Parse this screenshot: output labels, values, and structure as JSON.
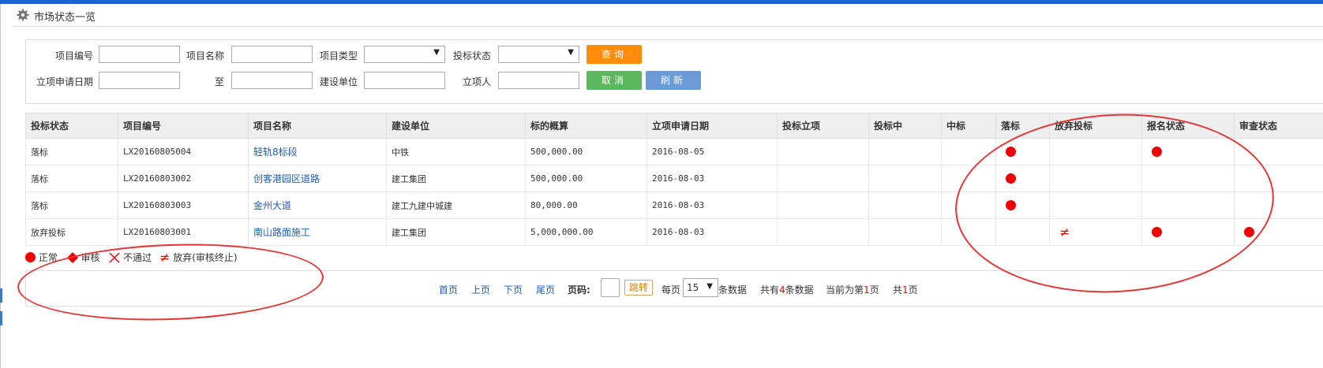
{
  "page": {
    "title": "市场状态一览"
  },
  "search": {
    "row1": [
      {
        "label": "项目编号",
        "type": "input",
        "value": ""
      },
      {
        "label": "项目名称",
        "type": "input",
        "value": ""
      },
      {
        "label": "项目类型",
        "type": "select",
        "value": ""
      },
      {
        "label": "投标状态",
        "type": "select",
        "value": ""
      }
    ],
    "row2": [
      {
        "label": "立项申请日期",
        "type": "input",
        "value": ""
      },
      {
        "label": "至",
        "type": "input",
        "value": ""
      },
      {
        "label": "建设单位",
        "type": "input",
        "value": ""
      },
      {
        "label": "立项人",
        "type": "input",
        "value": ""
      }
    ],
    "query_label": "查询",
    "cancel_label": "取消",
    "refresh_label": "刷新"
  },
  "table": {
    "columns": [
      "投标状态",
      "项目编号",
      "项目名称",
      "建设单位",
      "标的概算",
      "立项申请日期",
      "投标立项",
      "投标中",
      "中标",
      "落标",
      "放弃投标",
      "报名状态",
      "审查状态"
    ],
    "rows": [
      {
        "status": "落标",
        "code": "LX20160805004",
        "name": "轻轨8标段",
        "unit": "中铁",
        "budget": "500,000.00",
        "date": "2016-08-05",
        "marks": {
          "落标": "dot",
          "报名状态": "dot"
        }
      },
      {
        "status": "落标",
        "code": "LX20160803002",
        "name": "创客港园区道路",
        "unit": "建工集团",
        "budget": "500,000.00",
        "date": "2016-08-03",
        "marks": {
          "落标": "dot"
        }
      },
      {
        "status": "落标",
        "code": "LX20160803003",
        "name": "金州大道",
        "unit": "建工九建中城建",
        "budget": "80,000.00",
        "date": "2016-08-03",
        "marks": {
          "落标": "dot"
        }
      },
      {
        "status": "放弃投标",
        "code": "LX20160803001",
        "name": "南山路面施工",
        "unit": "建工集团",
        "budget": "5,000,000.00",
        "date": "2016-08-03",
        "marks": {
          "放弃投标": "neq",
          "报名状态": "dot",
          "审查状态": "dot"
        }
      }
    ]
  },
  "legend": {
    "normal": "正常",
    "review": "审核",
    "rejected": "不通过",
    "abandoned": "放弃(审核终止)"
  },
  "pager": {
    "first": "首页",
    "prev": "上页",
    "next": "下页",
    "last": "尾页",
    "page_code_label": "页码:",
    "page_code_value": "",
    "jump_label": "跳转",
    "per_page_prefix": "每页",
    "per_page_value": "15",
    "per_page_suffix": "条数据",
    "total_prefix": "共有",
    "total_count": "4",
    "total_suffix": "条数据",
    "current_prefix": "当前为第",
    "current_page": "1",
    "current_suffix": "页",
    "pages_prefix": "共",
    "pages_count": "1",
    "pages_suffix": "页"
  },
  "colors": {
    "accent_blue": "#1a66c7",
    "query_orange": "#ff8c0a",
    "cancel_green": "#5cb85c",
    "refresh_blue": "#6b9bd6",
    "mark_red": "#ee0000"
  }
}
